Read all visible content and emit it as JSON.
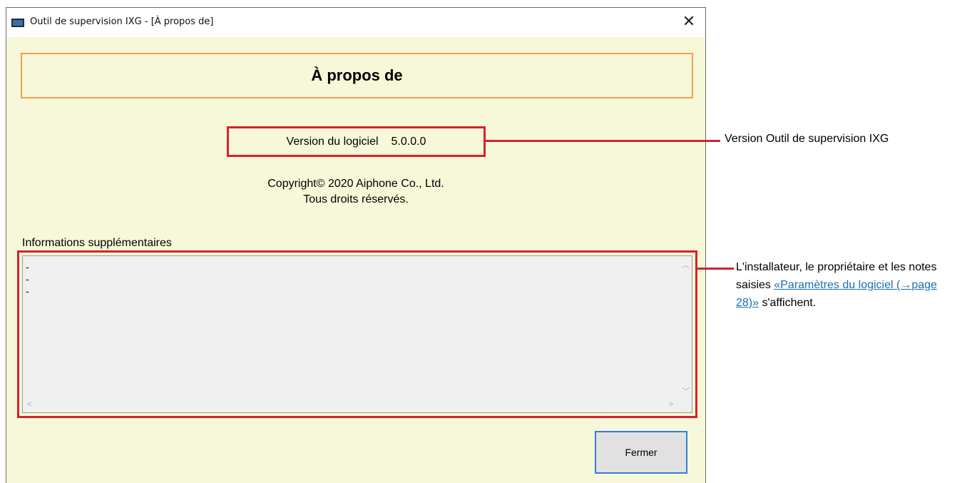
{
  "window": {
    "title": "Outil de supervision IXG - [À propos de]",
    "close_glyph": "✕"
  },
  "dialog": {
    "heading": "À propos de",
    "version_label": "Version du logiciel",
    "version_value": "5.0.0.0",
    "copyright_line1": "Copyright© 2020 Aiphone Co., Ltd.",
    "copyright_line2": "Tous droits réservés.",
    "info_label": "Informations supplémentaires",
    "info_lines": [
      "-",
      "-",
      "-"
    ],
    "close_button": "Fermer"
  },
  "annotations": {
    "version_note": "Version Outil de supervision IXG",
    "info_note_part1": "L'installateur, le propriétaire et les notes saisies ",
    "info_note_link": "«Paramètres du logiciel (→page 28)»",
    "info_note_part2": " s'affichent."
  },
  "icons": {
    "app": "app-window-icon",
    "close": "close-icon",
    "scroll_up": "scroll-up-icon",
    "scroll_down": "scroll-down-icon",
    "scroll_left": "scroll-left-icon",
    "scroll_right": "scroll-right-icon"
  },
  "colors": {
    "highlight": "#d4232b",
    "heading_border": "#f0a050",
    "dialog_bg": "#f7f7d9",
    "button_focus": "#2f7ed8",
    "link": "#1a6fb5"
  }
}
